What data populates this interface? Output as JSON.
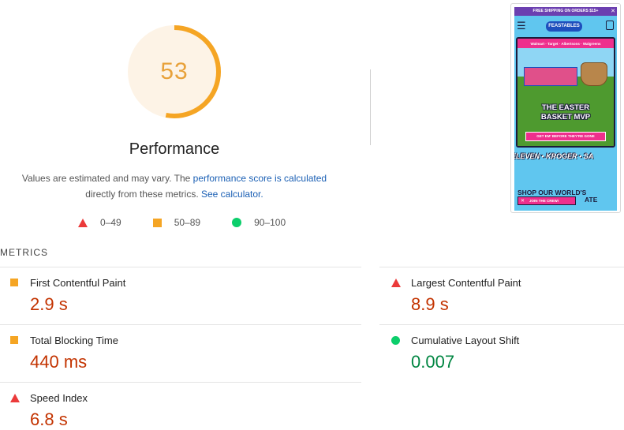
{
  "performance": {
    "score": "53",
    "score_fraction": 0.53,
    "title": "Performance",
    "note_prefix": "Values are estimated and may vary. The ",
    "note_link": "performance score is calculated",
    "note_middle": "directly from these metrics.",
    "calc_link": "See calculator."
  },
  "legend": [
    {
      "icon": "triangle",
      "label": "0–49"
    },
    {
      "icon": "square",
      "label": "50–89"
    },
    {
      "icon": "circle",
      "label": "90–100"
    }
  ],
  "colors": {
    "gauge_stroke": "#f5a524",
    "gauge_fill": "#fdf3e6",
    "fail": "#eb3a3a",
    "average": "#f5a524",
    "pass": "#0cce6b",
    "link": "#1a5fb4"
  },
  "screenshot": {
    "shipping_bar": "FREE SHIPPING ON ORDERS $15+",
    "logo": "FEASTABLES",
    "retailers": "Walmart · Target · Albertsons · Walgreens",
    "hero_title_line1": "THE EASTER",
    "hero_title_line2": "BASKET MVP",
    "hero_cta": "GET EM' BEFORE THEY'RE GONE",
    "ticker": "ELEVEN • KROGER • SA",
    "shop_heading_line1": "SHOP OUR WORLD'S",
    "shop_heading_line2": "ATE",
    "join_label": "JOIN THE CREW!"
  },
  "metrics": {
    "heading": "METRICS",
    "items": [
      {
        "name": "First Contentful Paint",
        "value": "2.9 s",
        "rating": "average"
      },
      {
        "name": "Largest Contentful Paint",
        "value": "8.9 s",
        "rating": "fail"
      },
      {
        "name": "Total Blocking Time",
        "value": "440 ms",
        "rating": "average"
      },
      {
        "name": "Cumulative Layout Shift",
        "value": "0.007",
        "rating": "pass"
      },
      {
        "name": "Speed Index",
        "value": "6.8 s",
        "rating": "fail"
      }
    ]
  }
}
